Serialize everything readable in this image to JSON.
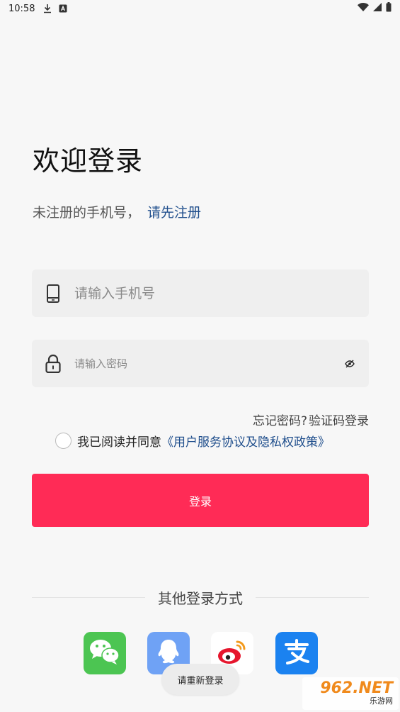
{
  "status_bar": {
    "time": "10:58",
    "icons_left": [
      "download-icon",
      "a-notification-icon"
    ],
    "icons_right": [
      "wifi-icon",
      "signal-icon",
      "battery-icon"
    ]
  },
  "page": {
    "title": "欢迎登录",
    "subtitle_text": "未注册的手机号，",
    "subtitle_link": "请先注册"
  },
  "form": {
    "phone": {
      "placeholder": "请输入手机号",
      "value": "",
      "icon": "phone-icon"
    },
    "password": {
      "placeholder": "请输入密码",
      "value": "",
      "icon": "lock-icon",
      "toggle_icon": "eye-off-icon"
    },
    "forgot_label": "忘记密码?",
    "code_login_label": "验证码登录",
    "agree_text": "我已阅读并同意",
    "agree_link": "《用户服务协议及隐私权政策》",
    "login_label": "登录"
  },
  "other_login": {
    "label": "其他登录方式",
    "providers": [
      "wechat",
      "qq",
      "weibo",
      "alipay"
    ]
  },
  "toast": {
    "text": "请重新登录"
  },
  "watermark": {
    "main": "962.NET",
    "sub": "乐游网"
  },
  "colors": {
    "accent": "#ff2b56",
    "link": "#1f4e8c",
    "background": "#f7f7f7",
    "field_bg": "#efefef"
  }
}
